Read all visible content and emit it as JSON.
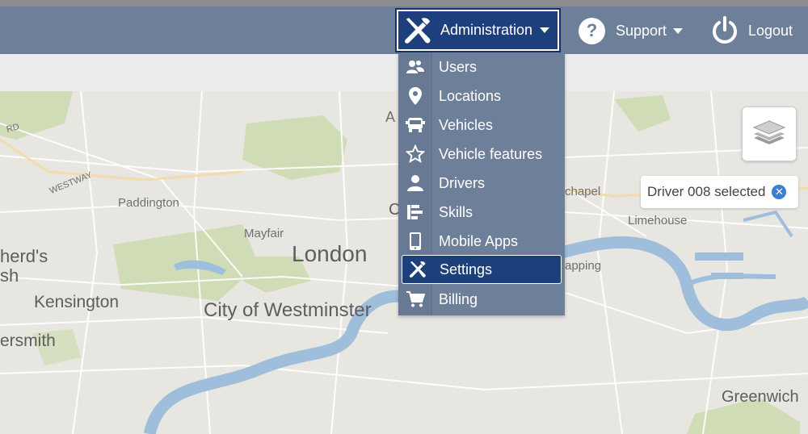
{
  "navbar": {
    "admin_label": "Administration",
    "support_label": "Support",
    "logout_label": "Logout"
  },
  "admin_menu": {
    "items": [
      {
        "label": "Users",
        "icon": "users-icon"
      },
      {
        "label": "Locations",
        "icon": "location-pin-icon"
      },
      {
        "label": "Vehicles",
        "icon": "vehicle-icon"
      },
      {
        "label": "Vehicle features",
        "icon": "star-icon"
      },
      {
        "label": "Drivers",
        "icon": "driver-icon"
      },
      {
        "label": "Skills",
        "icon": "skills-icon"
      },
      {
        "label": "Mobile Apps",
        "icon": "mobile-phone-icon"
      },
      {
        "label": "Settings",
        "icon": "wrench-screwdriver-icon",
        "active": true
      },
      {
        "label": "Billing",
        "icon": "cart-icon"
      }
    ]
  },
  "map": {
    "labels": {
      "london": "London",
      "westminster": "City of Westminster",
      "kensington": "Kensington",
      "paddington": "Paddington",
      "mayfair": "Mayfair",
      "shepherds": "herd's",
      "bush": "sh",
      "hammersmith": "ersmith",
      "westway": "WESTWAY",
      "rd": "RD",
      "chapel": "chapel",
      "limehouse": "Limehouse",
      "wapping": "apping",
      "greenwich": "Greenwich",
      "a_partial": "A",
      "c_partial": "C"
    }
  },
  "selection_chip": {
    "text": "Driver 008 selected"
  },
  "colors": {
    "navbar": "#6e7f99",
    "active": "#1d3f7c",
    "river": "#9fbedc",
    "park": "#cfdcb6"
  }
}
